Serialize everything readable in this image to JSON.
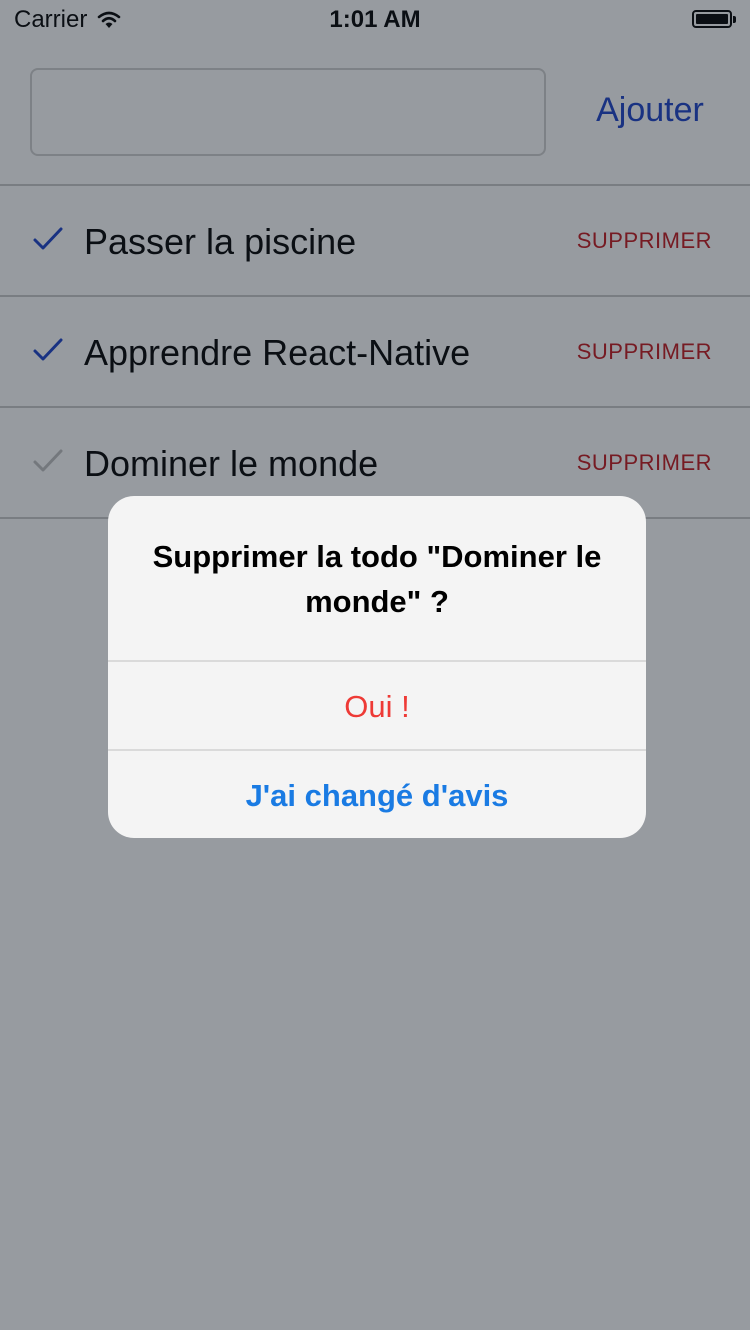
{
  "status_bar": {
    "carrier": "Carrier",
    "time": "1:01 AM"
  },
  "add_form": {
    "input_value": "",
    "add_label": "Ajouter"
  },
  "todos": [
    {
      "text": "Passer la piscine",
      "done": true,
      "delete_label": "SUPPRIMER"
    },
    {
      "text": "Apprendre React-Native",
      "done": true,
      "delete_label": "SUPPRIMER"
    },
    {
      "text": "Dominer le monde",
      "done": false,
      "delete_label": "SUPPRIMER"
    }
  ],
  "alert": {
    "title": "Supprimer la todo \"Dominer le monde\" ?",
    "confirm_label": "Oui !",
    "cancel_label": "J'ai changé d'avis"
  },
  "colors": {
    "accent": "#1a40c9",
    "delete": "#c4161c",
    "check_done": "#1a40c9",
    "check_pending": "#c0c0c0",
    "confirm": "#ee3a36",
    "cancel": "#1a7be3"
  },
  "icons": {
    "check": "check-icon",
    "wifi": "wifi-icon",
    "battery": "battery-icon"
  }
}
